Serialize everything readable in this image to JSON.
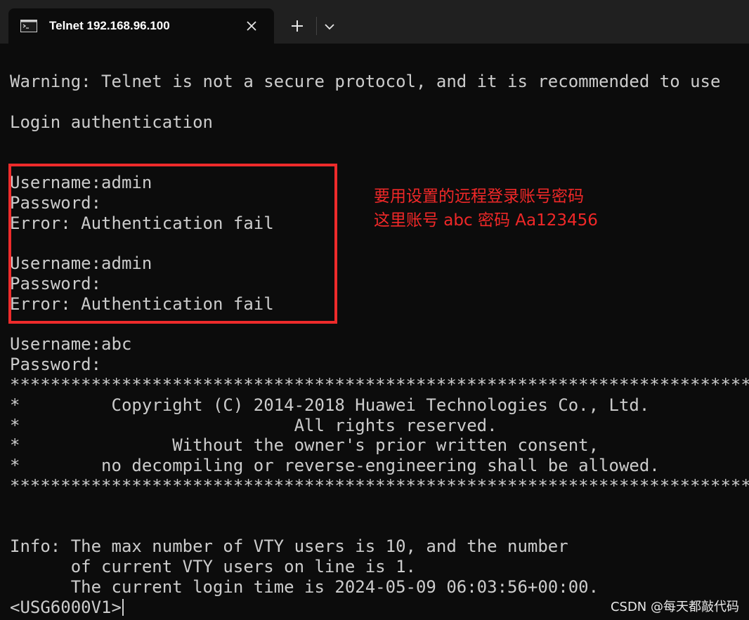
{
  "window": {
    "tab": {
      "title": "Telnet 192.168.96.100",
      "icon": "terminal-icon",
      "close_icon": "close-icon"
    },
    "new_tab_icon": "plus-icon",
    "dropdown_icon": "chevron-down-icon"
  },
  "terminal": {
    "lines": [
      "Warning: Telnet is not a secure protocol, and it is recommended to use",
      "",
      "Login authentication",
      "",
      "",
      "Username:admin",
      "Password:",
      "Error: Authentication fail",
      "",
      "Username:admin",
      "Password:",
      "Error: Authentication fail",
      "",
      "Username:abc",
      "Password:",
      "****************************************************************************",
      "*         Copyright (C) 2014-2018 Huawei Technologies Co., Ltd.",
      "*                           All rights reserved.",
      "*               Without the owner's prior written consent,",
      "*        no decompiling or reverse-engineering shall be allowed.",
      "****************************************************************************",
      "",
      "",
      "Info: The max number of VTY users is 10, and the number",
      "      of current VTY users on line is 1.",
      "      The current login time is 2024-05-09 06:03:56+00:00."
    ],
    "prompt": "<USG6000V1>"
  },
  "annotation": {
    "line1": "要用设置的远程登录账号密码",
    "line2": "这里账号 abc 密码 Aa123456",
    "box_color": "#ee2b2b",
    "text_color": "#f02828"
  },
  "watermark": "CSDN @每天都敲代码"
}
